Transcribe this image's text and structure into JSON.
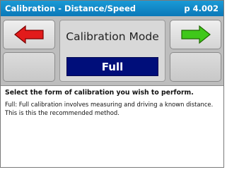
{
  "titlebar": {
    "title": "Calibration - Distance/Speed",
    "page": "p 4.002"
  },
  "nav": {
    "prev_icon": "red-left-arrow-icon",
    "next_icon": "green-right-arrow-icon"
  },
  "mode": {
    "title": "Calibration Mode",
    "value": "Full"
  },
  "content": {
    "instruction": "Select the form of calibration you wish to perform.",
    "description": "Full: Full calibration involves measuring and driving a known distance.  This is this the recommended method."
  },
  "colors": {
    "titlebar": "#0b78b8",
    "mode_value_bg": "#000e7a",
    "prev_arrow": "#e21b1b",
    "next_arrow": "#3fc81a"
  }
}
